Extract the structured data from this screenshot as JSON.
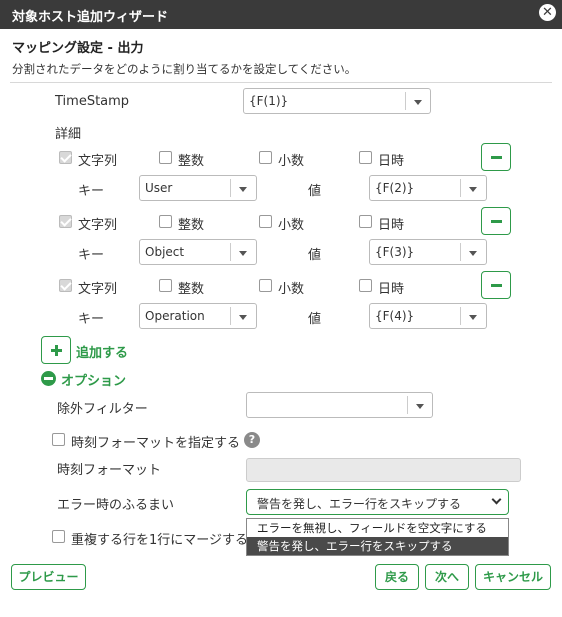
{
  "window": {
    "title": "対象ホスト追加ウィザード"
  },
  "section": {
    "title": "マッピング設定 - 出力",
    "description": "分割されたデータをどのように割り当てるかを設定してください。"
  },
  "timestamp": {
    "label": "TimeStamp",
    "value": "{F(1)}"
  },
  "details": {
    "label": "詳細",
    "rows": [
      {
        "type_string": "文字列",
        "type_int": "整数",
        "type_decimal": "小数",
        "type_datetime": "日時",
        "key_label": "キー",
        "key_value": "User",
        "value_label": "値",
        "value_value": "{F(2)}"
      },
      {
        "type_string": "文字列",
        "type_int": "整数",
        "type_decimal": "小数",
        "type_datetime": "日時",
        "key_label": "キー",
        "key_value": "Object",
        "value_label": "値",
        "value_value": "{F(3)}"
      },
      {
        "type_string": "文字列",
        "type_int": "整数",
        "type_decimal": "小数",
        "type_datetime": "日時",
        "key_label": "キー",
        "key_value": "Operation",
        "value_label": "値",
        "value_value": "{F(4)}"
      }
    ],
    "add_label": "追加する"
  },
  "options": {
    "label": "オプション",
    "exclude_filter": {
      "label": "除外フィルター",
      "value": ""
    },
    "time_format_toggle": {
      "label": "時刻フォーマットを指定する",
      "help": "?"
    },
    "time_format": {
      "label": "時刻フォーマット",
      "value": ""
    },
    "error_behavior": {
      "label": "エラー時のふるまい",
      "selected": "警告を発し、エラー行をスキップする",
      "options": [
        "エラーを無視し、フィールドを空文字にする",
        "警告を発し、エラー行をスキップする"
      ]
    },
    "merge_duplicates": {
      "label": "重複する行を1行にマージする"
    }
  },
  "footer": {
    "preview": "プレビュー",
    "back": "戻る",
    "next": "次へ",
    "cancel": "キャンセル"
  },
  "colors": {
    "accent": "#2e9a49",
    "titlebar": "#3a3a3a"
  }
}
